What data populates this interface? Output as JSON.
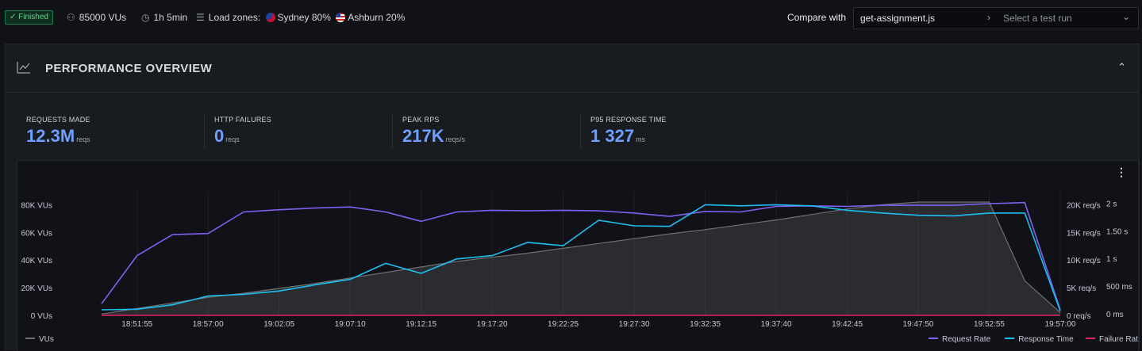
{
  "topbar": {
    "status": "✓ Finished",
    "vus": "85000 VUs",
    "duration": "1h 5min",
    "load_zones_label": "Load zones:",
    "zone1": "Sydney 80%",
    "zone2": "Ashburn 20%",
    "compare_label": "Compare with",
    "compare_script": "get-assignment.js",
    "select_placeholder": "Select a test run"
  },
  "panel": {
    "title": "PERFORMANCE OVERVIEW",
    "stats": [
      {
        "label": "REQUESTS MADE",
        "value": "12.3M",
        "unit": "reqs"
      },
      {
        "label": "HTTP FAILURES",
        "value": "0",
        "unit": "reqs"
      },
      {
        "label": "PEAK RPS",
        "value": "217K",
        "unit": "reqs/s"
      },
      {
        "label": "P95 RESPONSE TIME",
        "value": "1 327",
        "unit": "ms"
      }
    ]
  },
  "chart_data": {
    "type": "line",
    "x": [
      "18:50:30",
      "18:51:55",
      "18:54:30",
      "18:57:00",
      "18:59:30",
      "19:02:05",
      "19:04:30",
      "19:07:10",
      "19:09:40",
      "19:12:15",
      "19:14:45",
      "19:17:20",
      "19:19:50",
      "19:22:25",
      "19:24:55",
      "19:27:30",
      "19:30:00",
      "19:32:35",
      "19:35:05",
      "19:37:40",
      "19:40:10",
      "19:42:45",
      "19:45:15",
      "19:47:50",
      "19:50:20",
      "19:52:55",
      "19:55:00",
      "19:57:00"
    ],
    "x_ticks": [
      "18:51:55",
      "18:57:00",
      "19:02:05",
      "19:07:10",
      "19:12:15",
      "19:17:20",
      "19:22:25",
      "19:27:30",
      "19:32:35",
      "19:37:40",
      "19:42:45",
      "19:47:50",
      "19:52:55",
      "19:57:00"
    ],
    "left_axis": {
      "ticks": [
        "0 VUs",
        "20K VUs",
        "40K VUs",
        "60K VUs",
        "80K VUs"
      ],
      "ylim": [
        0,
        90000
      ]
    },
    "right_axis_1": {
      "ticks": [
        "0 req/s",
        "5K req/s",
        "10K req/s",
        "15K req/s",
        "20K req/s"
      ],
      "ylim": [
        0,
        22500
      ]
    },
    "right_axis_2": {
      "ticks": [
        "0 ms",
        "500 ms",
        "1 s",
        "1.50 s",
        "2 s"
      ],
      "ylim": [
        0,
        2250
      ]
    },
    "series": [
      {
        "name": "VUs",
        "axis": "left",
        "color": "#6e6e73",
        "fill": true,
        "values": [
          1000,
          5000,
          9000,
          13000,
          16000,
          19500,
          23000,
          27000,
          31000,
          35000,
          39000,
          42000,
          45000,
          48500,
          52000,
          55500,
          59000,
          62000,
          65500,
          69000,
          73000,
          77000,
          80000,
          82000,
          82000,
          82000,
          25000,
          2000
        ]
      },
      {
        "name": "Request Rate",
        "axis": "right_1",
        "color": "#8060f0",
        "values": [
          2100,
          10800,
          14600,
          14800,
          18700,
          19100,
          19400,
          19600,
          18700,
          17000,
          18700,
          19000,
          18900,
          19000,
          18900,
          18500,
          17900,
          18800,
          18700,
          19700,
          19800,
          19700,
          19900,
          19900,
          19900,
          20200,
          20400,
          1000
        ]
      },
      {
        "name": "Response Time",
        "axis": "right_2",
        "color": "#1fbef0",
        "values": [
          100,
          110,
          190,
          350,
          380,
          440,
          550,
          650,
          940,
          760,
          1020,
          1080,
          1320,
          1260,
          1720,
          1620,
          1610,
          2000,
          1980,
          2000,
          1980,
          1900,
          1850,
          1810,
          1800,
          1850,
          1850,
          80
        ]
      },
      {
        "name": "Failure Rate",
        "axis": "right_1",
        "color": "#e0226e",
        "values": [
          0,
          0,
          0,
          0,
          0,
          0,
          0,
          0,
          0,
          0,
          0,
          0,
          0,
          0,
          0,
          0,
          0,
          0,
          0,
          0,
          0,
          0,
          0,
          0,
          0,
          0,
          0,
          0
        ]
      }
    ]
  }
}
